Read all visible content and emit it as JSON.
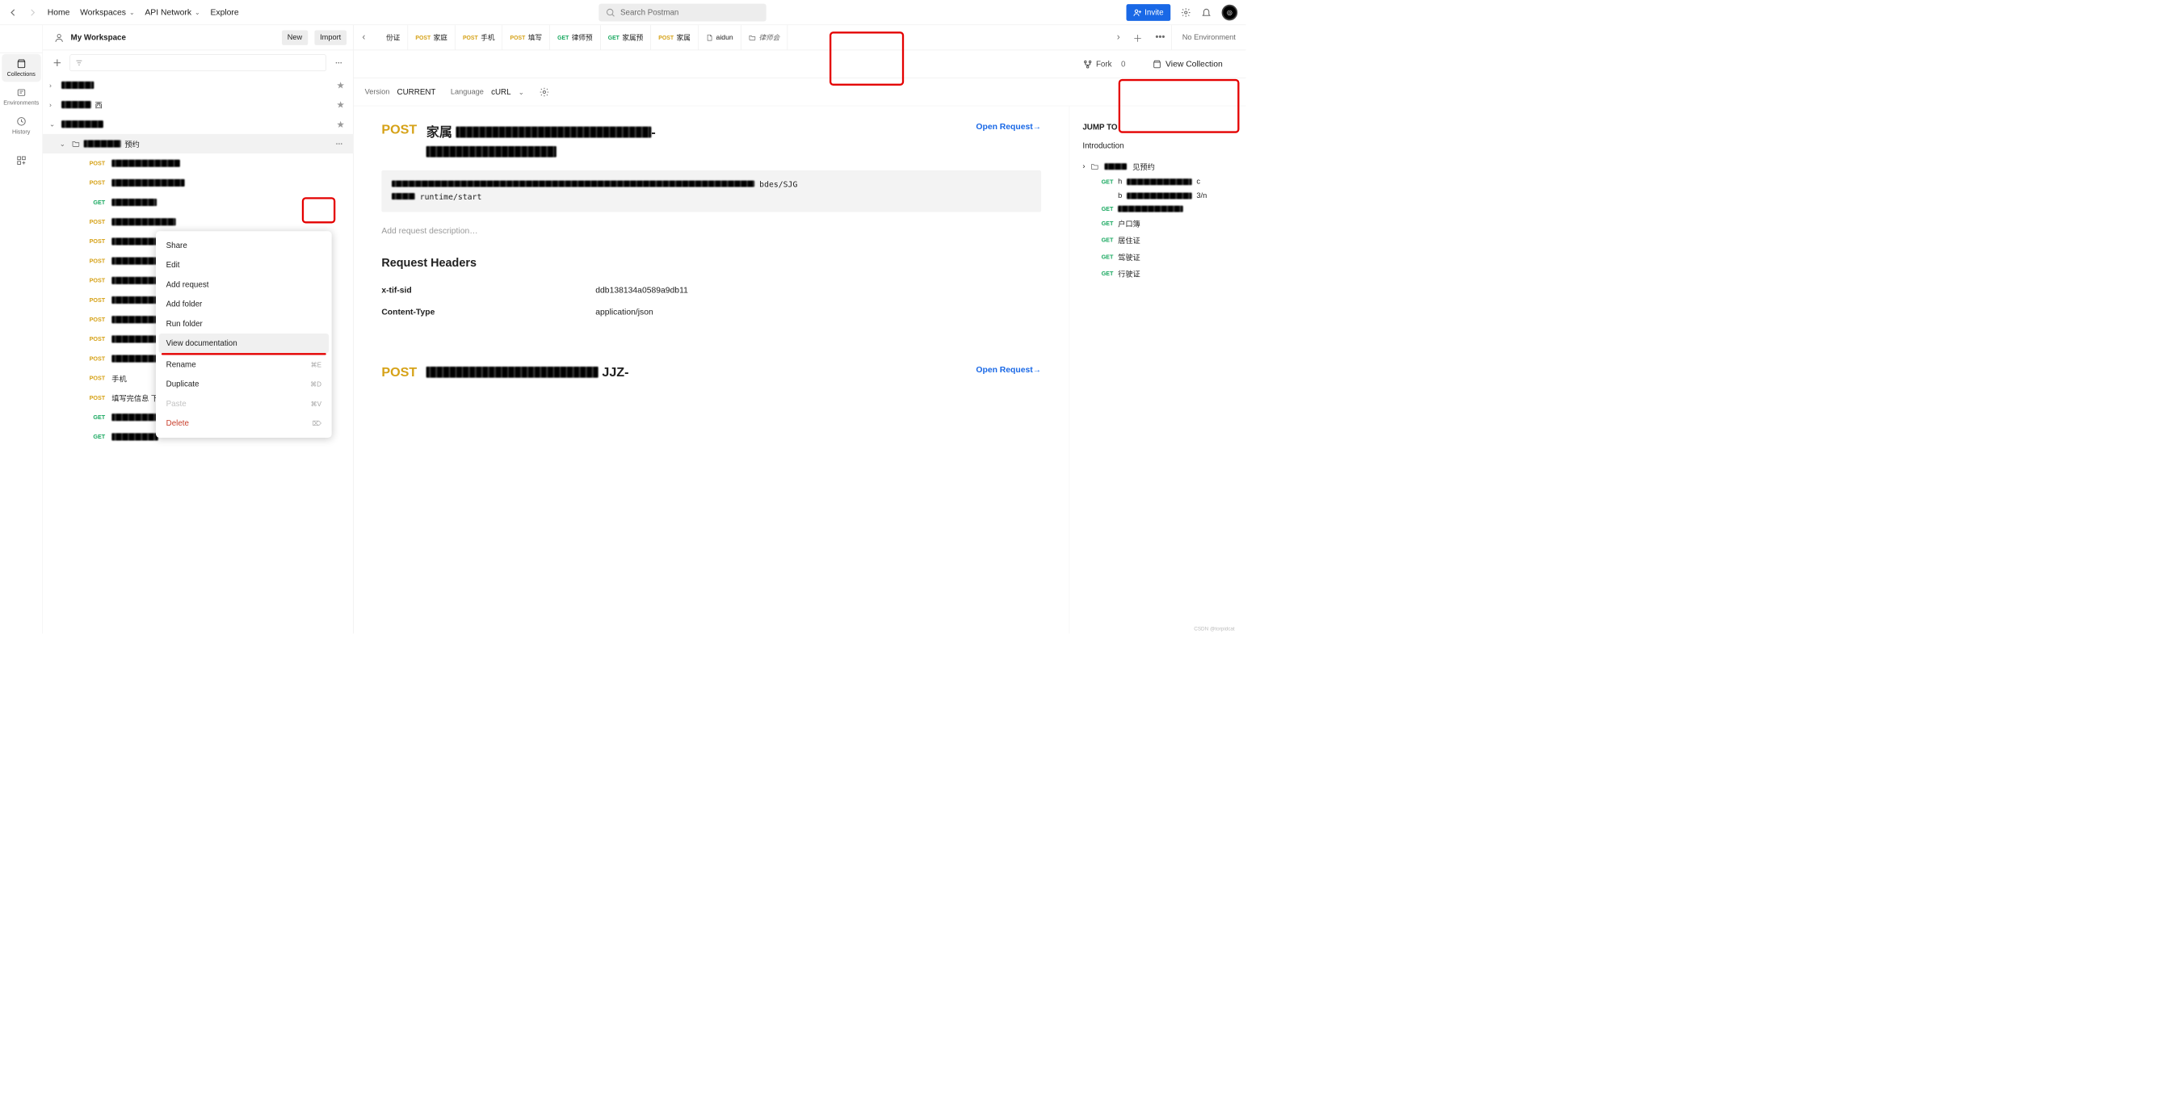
{
  "topbar": {
    "home": "Home",
    "workspaces": "Workspaces",
    "api_network": "API Network",
    "explore": "Explore",
    "search_placeholder": "Search Postman",
    "invite": "Invite"
  },
  "workspace": {
    "name": "My Workspace",
    "new": "New",
    "import": "Import"
  },
  "rail": {
    "collections": "Collections",
    "environments": "Environments",
    "history": "History"
  },
  "tree": {
    "folder_suffix_1": "西",
    "folder_open_suffix": "预约",
    "items": [
      {
        "method": "POST",
        "blur": 1
      },
      {
        "method": "POST",
        "blur": 1
      },
      {
        "method": "GET",
        "blur": 1
      },
      {
        "method": "POST",
        "blur": 1
      },
      {
        "method": "POST",
        "blur": 1
      },
      {
        "method": "POST",
        "blur": 1
      },
      {
        "method": "POST",
        "blur": 1
      },
      {
        "method": "POST",
        "blur": 1
      },
      {
        "method": "POST",
        "blur": 1
      },
      {
        "method": "POST",
        "blur": 1
      },
      {
        "method": "POST",
        "blur": 1
      },
      {
        "method": "POST",
        "label": "手机"
      },
      {
        "method": "POST",
        "label": "填写完信息 下一步"
      },
      {
        "method": "GET",
        "blur": 1
      },
      {
        "method": "GET",
        "blur": 1
      }
    ]
  },
  "ctxmenu": {
    "share": "Share",
    "edit": "Edit",
    "add_request": "Add request",
    "add_folder": "Add folder",
    "run_folder": "Run folder",
    "view_documentation": "View documentation",
    "rename": "Rename",
    "rename_sc": "⌘E",
    "duplicate": "Duplicate",
    "duplicate_sc": "⌘D",
    "paste": "Paste",
    "paste_sc": "⌘V",
    "delete": "Delete",
    "delete_sc": "⌦"
  },
  "tabs": [
    {
      "method": "",
      "label": "份证",
      "blur_label": true
    },
    {
      "method": "POST",
      "label": "家庭"
    },
    {
      "method": "POST",
      "label": "手机"
    },
    {
      "method": "POST",
      "label": "填写"
    },
    {
      "method": "GET",
      "label": "律师预"
    },
    {
      "method": "GET",
      "label": "家属预"
    },
    {
      "method": "POST",
      "label": "家属"
    },
    {
      "icon": "doc",
      "label": "aidun"
    },
    {
      "icon": "folder",
      "label": "律师会"
    }
  ],
  "no_env": "No Environment",
  "subhdr": {
    "fork": "Fork",
    "fork_n": "0",
    "view_collection": "View Collection"
  },
  "optsbar": {
    "version_l": "Version",
    "version_v": "CURRENT",
    "lang_l": "Language",
    "lang_v": "cURL"
  },
  "doc": {
    "post1_title_prefix": "家属",
    "open_request": "Open Request",
    "open_request_arrow": "→",
    "url_suffix1": "bdes/SJG",
    "url_suffix2": "runtime/start",
    "desc_ph": "Add request description…",
    "req_headers": "Request Headers",
    "headers": [
      {
        "k": "x-tif-sid",
        "v": "ddb138134a0589a9db11"
      },
      {
        "k": "Content-Type",
        "v": "application/json"
      }
    ],
    "post2_title_suffix": "JJZ-"
  },
  "jump": {
    "title": "JUMP TO",
    "intro": "Introduction",
    "folder_suffix": "见预约",
    "items": [
      {
        "method": "GET",
        "blur": true,
        "text_l": "h",
        "text_r": "c"
      },
      {
        "method": "",
        "text_l": "b",
        "text_r": "3/n"
      },
      {
        "method": "GET",
        "blur": true
      },
      {
        "method": "GET",
        "label": "户口簿"
      },
      {
        "method": "GET",
        "label": "居住证"
      },
      {
        "method": "GET",
        "label": "驾驶证"
      },
      {
        "method": "GET",
        "label": "行驶证"
      }
    ]
  },
  "watermark": "CSDN @torpidcat"
}
